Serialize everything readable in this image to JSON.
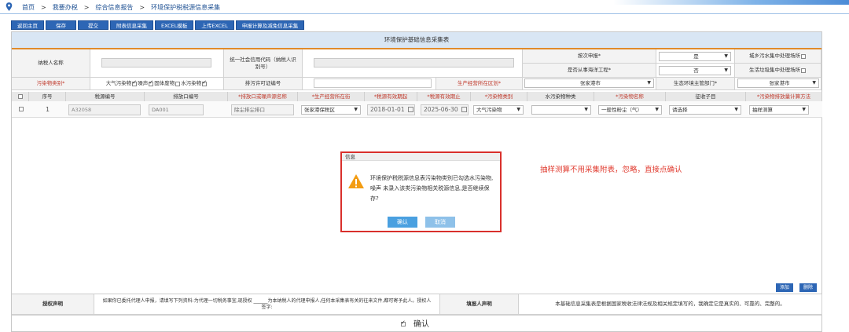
{
  "breadcrumb": {
    "items": [
      "首页",
      "我要办税",
      "综合信息报告",
      "环境保护税税源信息采集"
    ],
    "separator": ">"
  },
  "toolbar": {
    "buttons": [
      "返回主页",
      "保存",
      "提交",
      "附表信息采集",
      "EXCEL模板",
      "上传EXCEL",
      "申报计算及减免信息采集"
    ]
  },
  "form": {
    "title": "环境保护基础信息采集表",
    "taxpayer_name_label": "纳税人名称",
    "credit_code_label": "统一社会信用代码（纳税人识别号）",
    "declare_label": "按次申报*",
    "declare_value": "是",
    "sea_label": "是否从事海洋工程*",
    "sea_value": "否",
    "urban_sewage_label": "城乡污水集中处理场所",
    "garbage_label": "生活垃圾集中处理场所",
    "pollutant_type_label": "污染物类别*",
    "pollutant_types": [
      {
        "label": "大气污染物",
        "checked": true
      },
      {
        "label": "噪声",
        "checked": true
      },
      {
        "label": "固体废物",
        "checked": false
      },
      {
        "label": "水污染物",
        "checked": true
      }
    ],
    "permit_label": "排污许可证编号",
    "district_label": "生产经营所在区划*",
    "district_value": "张家港市",
    "eco_dept_label": "生态环境主管部门*",
    "eco_dept_value": "张家港市"
  },
  "table": {
    "headers": [
      "序号",
      "税源编号",
      "排放口编号",
      "*排放口或噪声源名称",
      "*生产经营所在街",
      "*税源有效期起",
      "*税源有效期止",
      "*污染物类别",
      "水污染物种类",
      "*污染物名称",
      "征收子目",
      "*污染物排放量计算方法"
    ],
    "rows": [
      {
        "index": "1",
        "source_no": "A32058",
        "outlet_no": "DA001",
        "outlet_name": "除尘排尘排口",
        "street": "张家港保税区",
        "start": "2018-01-01",
        "end": "2025-06-30",
        "category": "大气污染物",
        "water_type": "",
        "pollutant": "一般性粉尘（气）",
        "sub_item": "请选择",
        "method": "抽样测算"
      }
    ]
  },
  "actions": {
    "add": "添加",
    "delete": "删除"
  },
  "footer": {
    "auth_label": "授权声明",
    "auth_text": "如果你已委托代理人申报，请填写下列资料:为代理一切税务事宜,现授权 ______为本纳税人的代理申报人,任何本采集表有关的往来文件,都可寄予此人。授权人签字:",
    "filer_label": "填报人声明",
    "filer_text": "本基础信息采集表是根据国家税收法律法规及相关规定填写的，我确定它是真实的、可靠的、完整的。",
    "confirm": "确认"
  },
  "modal": {
    "title": "信息",
    "message": "环境保护税税源信息表污染物类别已勾选水污染物,噪声 未录入该类污染物相关税源信息,是否继续保存?",
    "confirm": "确认",
    "cancel": "取消"
  },
  "annotation": "抽样测算不用采集附表，忽略，直接点确认",
  "colors": {
    "primary": "#2d66b5",
    "accent": "#e08a2a",
    "annotation": "#e03a2e"
  }
}
